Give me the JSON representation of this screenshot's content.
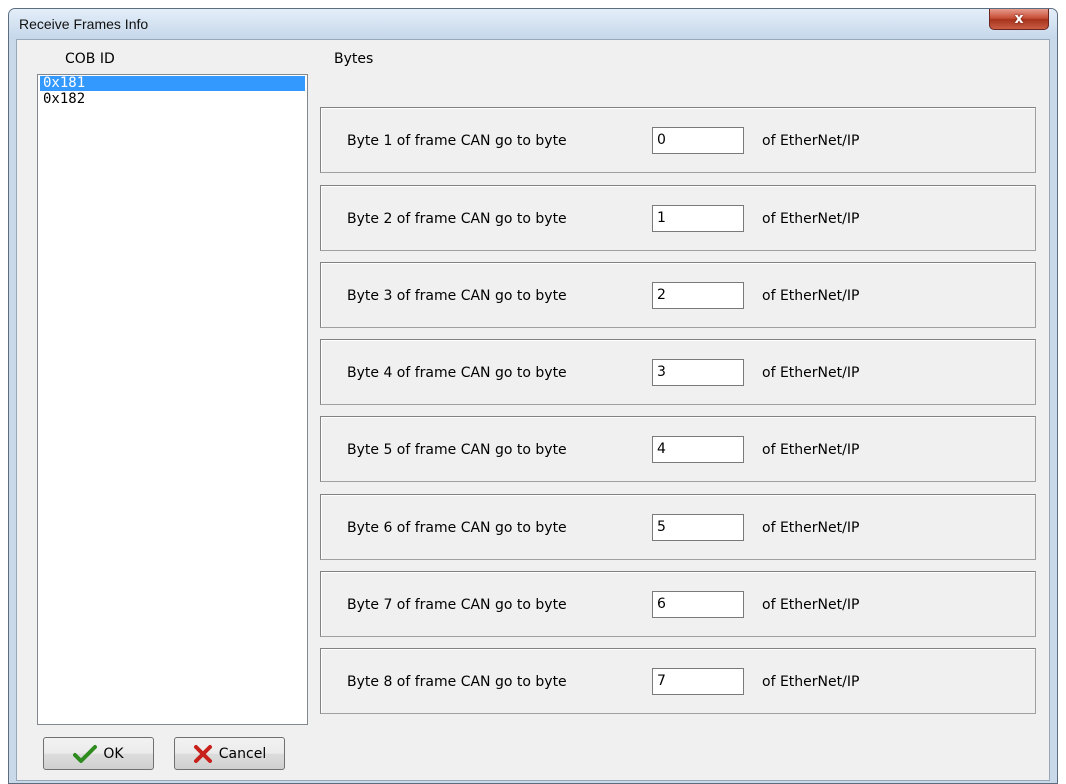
{
  "window": {
    "title": "Receive Frames Info",
    "close_glyph": "x"
  },
  "cob_id": {
    "label": "COB ID",
    "items": [
      {
        "text": "0x181",
        "selected": true
      },
      {
        "text": "0x182",
        "selected": false
      }
    ]
  },
  "bytes": {
    "label": "Bytes",
    "rows": [
      {
        "prefix": "Byte 1 of frame CAN go to byte",
        "value": "0",
        "suffix": "of EtherNet/IP"
      },
      {
        "prefix": "Byte 2 of frame CAN go to byte",
        "value": "1",
        "suffix": "of EtherNet/IP"
      },
      {
        "prefix": "Byte 3 of frame CAN go to byte",
        "value": "2",
        "suffix": "of EtherNet/IP"
      },
      {
        "prefix": "Byte 4 of frame CAN go to byte",
        "value": "3",
        "suffix": "of EtherNet/IP"
      },
      {
        "prefix": "Byte 5 of frame CAN go to byte",
        "value": "4",
        "suffix": "of EtherNet/IP"
      },
      {
        "prefix": "Byte 6 of frame CAN go to byte",
        "value": "5",
        "suffix": "of EtherNet/IP"
      },
      {
        "prefix": "Byte 7 of frame CAN go to byte",
        "value": "6",
        "suffix": "of EtherNet/IP"
      },
      {
        "prefix": "Byte 8 of frame CAN go to byte",
        "value": "7",
        "suffix": "of EtherNet/IP"
      }
    ]
  },
  "buttons": {
    "ok_label": "OK",
    "cancel_label": "Cancel"
  },
  "icons": {
    "ok": "checkmark-icon",
    "cancel": "x-cross-icon"
  },
  "colors": {
    "selection": "#3399ff",
    "ok_icon": "#2e8b1e",
    "cancel_icon": "#c8201a"
  }
}
